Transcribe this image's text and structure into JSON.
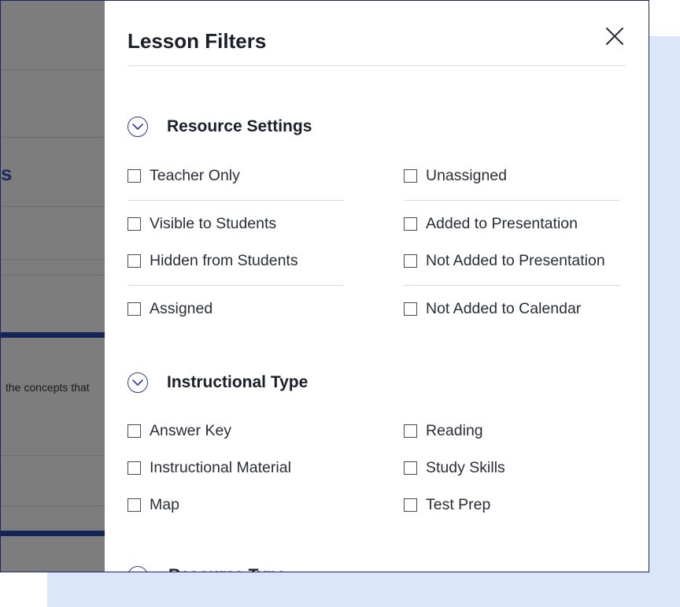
{
  "background": {
    "heading_fragment": "s",
    "snippet": "the concepts that"
  },
  "dialog": {
    "title": "Lesson Filters",
    "next_section_partial": "Resource Type"
  },
  "sections": [
    {
      "title": "Resource Settings",
      "options": [
        "Teacher Only",
        "Unassigned",
        "Visible to Students",
        "Added to Presentation",
        "Hidden from Students",
        "Not Added to Presentation",
        "Assigned",
        "Not Added to Calendar"
      ]
    },
    {
      "title": "Instructional Type",
      "options": [
        "Answer Key",
        "Reading",
        "Instructional Material",
        "Study Skills",
        "Map",
        "Test Prep"
      ]
    }
  ],
  "colors": {
    "overlay": "#7d7d7d",
    "accent": "#2b3e9c",
    "navy": "#142456",
    "backdrop": "#dce6fb"
  }
}
